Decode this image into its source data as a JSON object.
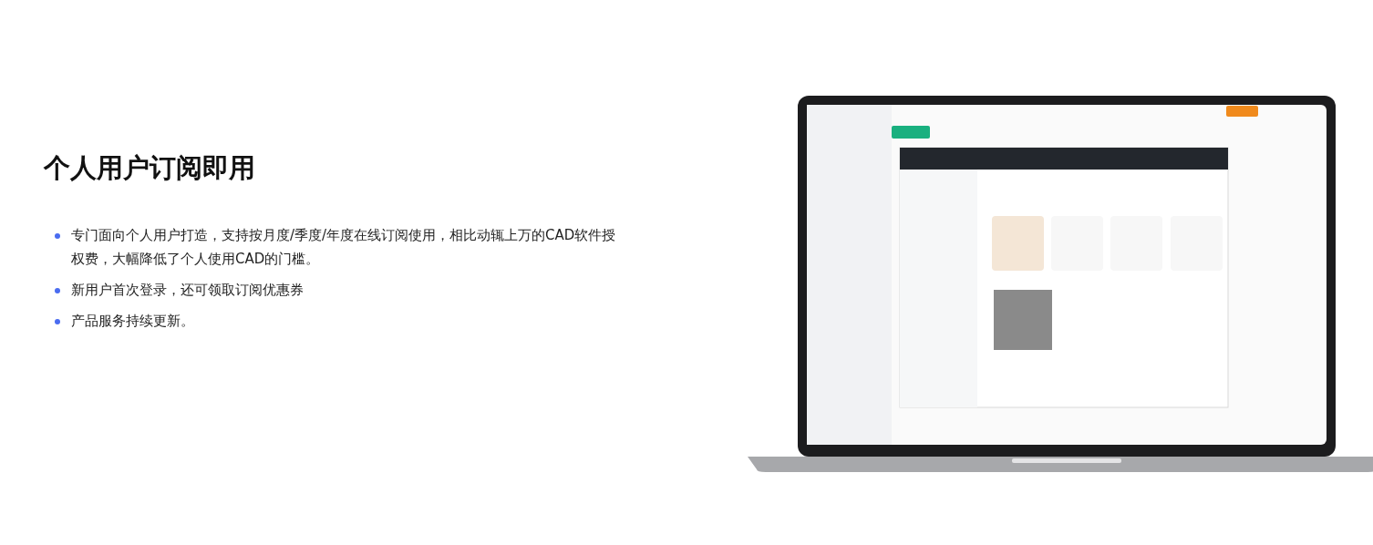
{
  "heading": "个人用户订阅即用",
  "bullets": [
    "专门面向个人用户打造，支持按月度/季度/年度在线订阅使用，相比动辄上万的CAD软件授权费，大幅降低了个人使用CAD的门槛。",
    "新用户首次登录，还可领取订阅优惠券",
    "产品服务持续更新。"
  ]
}
